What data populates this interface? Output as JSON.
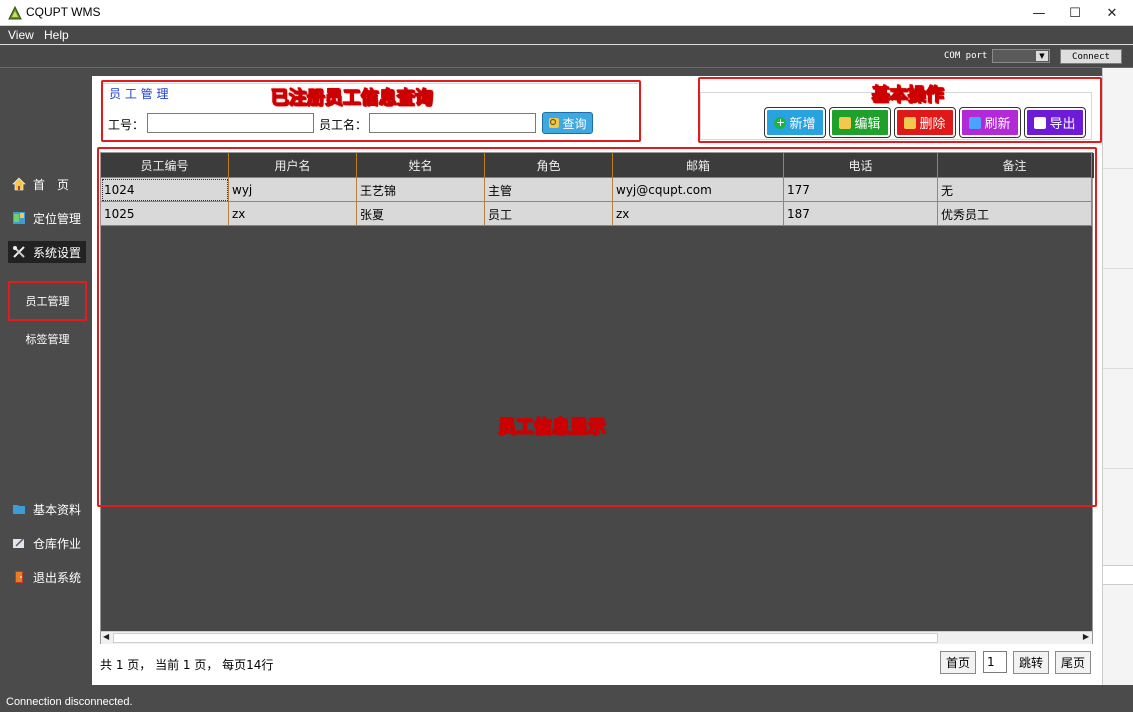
{
  "window": {
    "title": "CQUPT WMS",
    "minimize": "—",
    "maximize": "☐",
    "close": "✕"
  },
  "menu": {
    "items": [
      "View",
      "Help"
    ]
  },
  "portbar": {
    "com_label": "COM port",
    "com_value": "",
    "connect_label": "Connect"
  },
  "sidebar": {
    "items": [
      {
        "label": "首　页",
        "icon": "home-icon"
      },
      {
        "label": "定位管理",
        "icon": "map-icon"
      },
      {
        "label": "系统设置",
        "icon": "tools-icon"
      }
    ],
    "subitems": [
      {
        "label": "员工管理"
      },
      {
        "label": "标签管理"
      }
    ],
    "bottom": [
      {
        "label": "基本资料",
        "icon": "folder-icon"
      },
      {
        "label": "仓库作业",
        "icon": "edit-icon"
      },
      {
        "label": "退出系统",
        "icon": "exit-icon"
      }
    ]
  },
  "query": {
    "title": "员 工 管 理",
    "emp_id_label": "工号：",
    "emp_id_value": "",
    "emp_name_label": "员工名：",
    "emp_name_value": "",
    "query_button": "查询"
  },
  "operations": {
    "add": "新增",
    "edit": "编辑",
    "delete": "删除",
    "refresh": "刷新",
    "export": "导出"
  },
  "annotations": {
    "query_area": "已注册员工信息查询",
    "ops_area": "基本操作",
    "grid_area": "员工信息显示"
  },
  "table": {
    "columns": [
      "员工编号",
      "用户名",
      "姓名",
      "角色",
      "邮箱",
      "电话",
      "备注"
    ],
    "rows": [
      [
        "1024",
        "wyj",
        "王艺锦",
        "主管",
        "wyj@cqupt.com",
        "177",
        "无"
      ],
      [
        "1025",
        "zx",
        "张夏",
        "员工",
        "zx",
        "187",
        "优秀员工"
      ]
    ]
  },
  "pagination": {
    "info": "共 1 页， 当前 1 页， 每页14行",
    "first": "首页",
    "page_value": "1",
    "jump": "跳转",
    "last": "尾页"
  },
  "status": {
    "text": "Connection disconnected."
  },
  "colors": {
    "accent_red": "#e21c1c",
    "add": "#29a3e0",
    "edit": "#1fa02a",
    "delete": "#e01818",
    "refresh": "#b12ad6",
    "export": "#6d1bd6"
  }
}
